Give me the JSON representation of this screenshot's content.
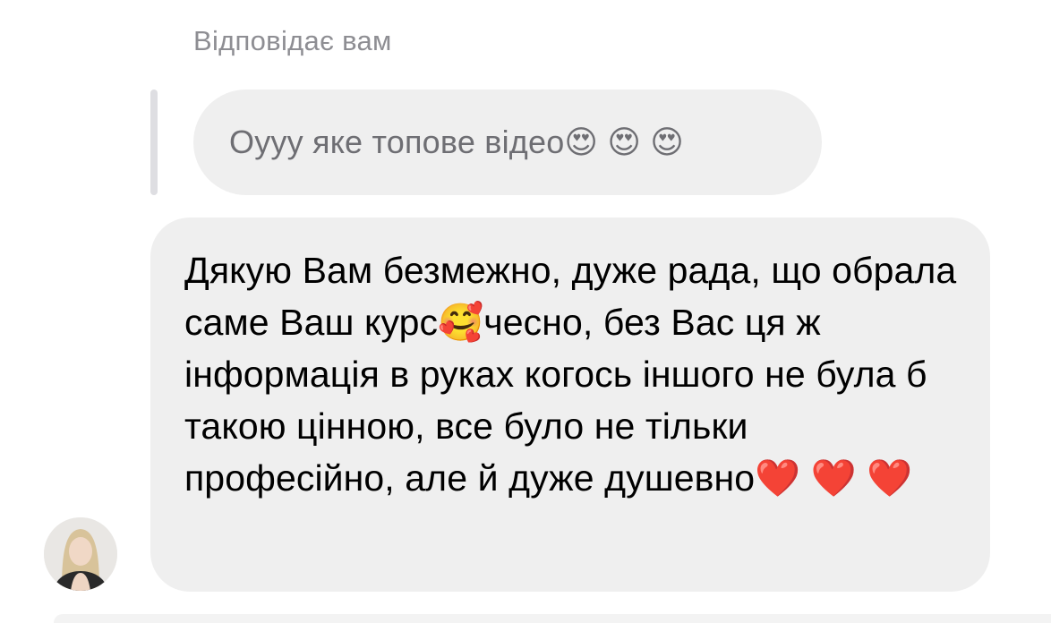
{
  "reply": {
    "header": "Відповідає вам",
    "quoted_message": "Оууу яке топове відео😍 😍 😍"
  },
  "message": {
    "text": "Дякую Вам безмежно, дуже рада, що обрала саме Ваш курс🥰чесно, без Вас ця ж інформація в руках когось іншого не була б такою цінною, все було не тільки професійно, але й дуже душевно❤️ ❤️ ❤️"
  },
  "sender": {
    "avatar_icon": "user-avatar"
  },
  "colors": {
    "bubble": "#efefef",
    "quote_bar": "#dedee2",
    "secondary_text": "#8e8e93"
  }
}
